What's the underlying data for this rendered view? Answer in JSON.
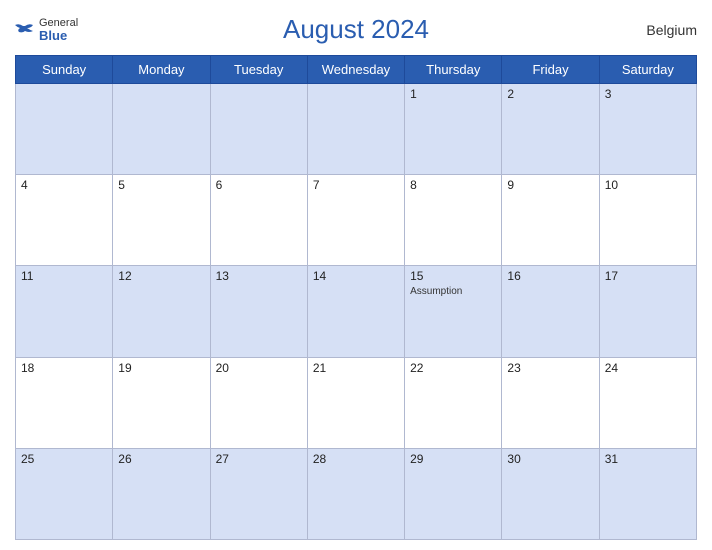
{
  "header": {
    "title": "August 2024",
    "country": "Belgium",
    "logo": {
      "general": "General",
      "blue": "Blue"
    }
  },
  "weekdays": [
    "Sunday",
    "Monday",
    "Tuesday",
    "Wednesday",
    "Thursday",
    "Friday",
    "Saturday"
  ],
  "weeks": [
    [
      {
        "day": "",
        "event": ""
      },
      {
        "day": "",
        "event": ""
      },
      {
        "day": "",
        "event": ""
      },
      {
        "day": "",
        "event": ""
      },
      {
        "day": "1",
        "event": ""
      },
      {
        "day": "2",
        "event": ""
      },
      {
        "day": "3",
        "event": ""
      }
    ],
    [
      {
        "day": "4",
        "event": ""
      },
      {
        "day": "5",
        "event": ""
      },
      {
        "day": "6",
        "event": ""
      },
      {
        "day": "7",
        "event": ""
      },
      {
        "day": "8",
        "event": ""
      },
      {
        "day": "9",
        "event": ""
      },
      {
        "day": "10",
        "event": ""
      }
    ],
    [
      {
        "day": "11",
        "event": ""
      },
      {
        "day": "12",
        "event": ""
      },
      {
        "day": "13",
        "event": ""
      },
      {
        "day": "14",
        "event": ""
      },
      {
        "day": "15",
        "event": "Assumption"
      },
      {
        "day": "16",
        "event": ""
      },
      {
        "day": "17",
        "event": ""
      }
    ],
    [
      {
        "day": "18",
        "event": ""
      },
      {
        "day": "19",
        "event": ""
      },
      {
        "day": "20",
        "event": ""
      },
      {
        "day": "21",
        "event": ""
      },
      {
        "day": "22",
        "event": ""
      },
      {
        "day": "23",
        "event": ""
      },
      {
        "day": "24",
        "event": ""
      }
    ],
    [
      {
        "day": "25",
        "event": ""
      },
      {
        "day": "26",
        "event": ""
      },
      {
        "day": "27",
        "event": ""
      },
      {
        "day": "28",
        "event": ""
      },
      {
        "day": "29",
        "event": ""
      },
      {
        "day": "30",
        "event": ""
      },
      {
        "day": "31",
        "event": ""
      }
    ]
  ]
}
